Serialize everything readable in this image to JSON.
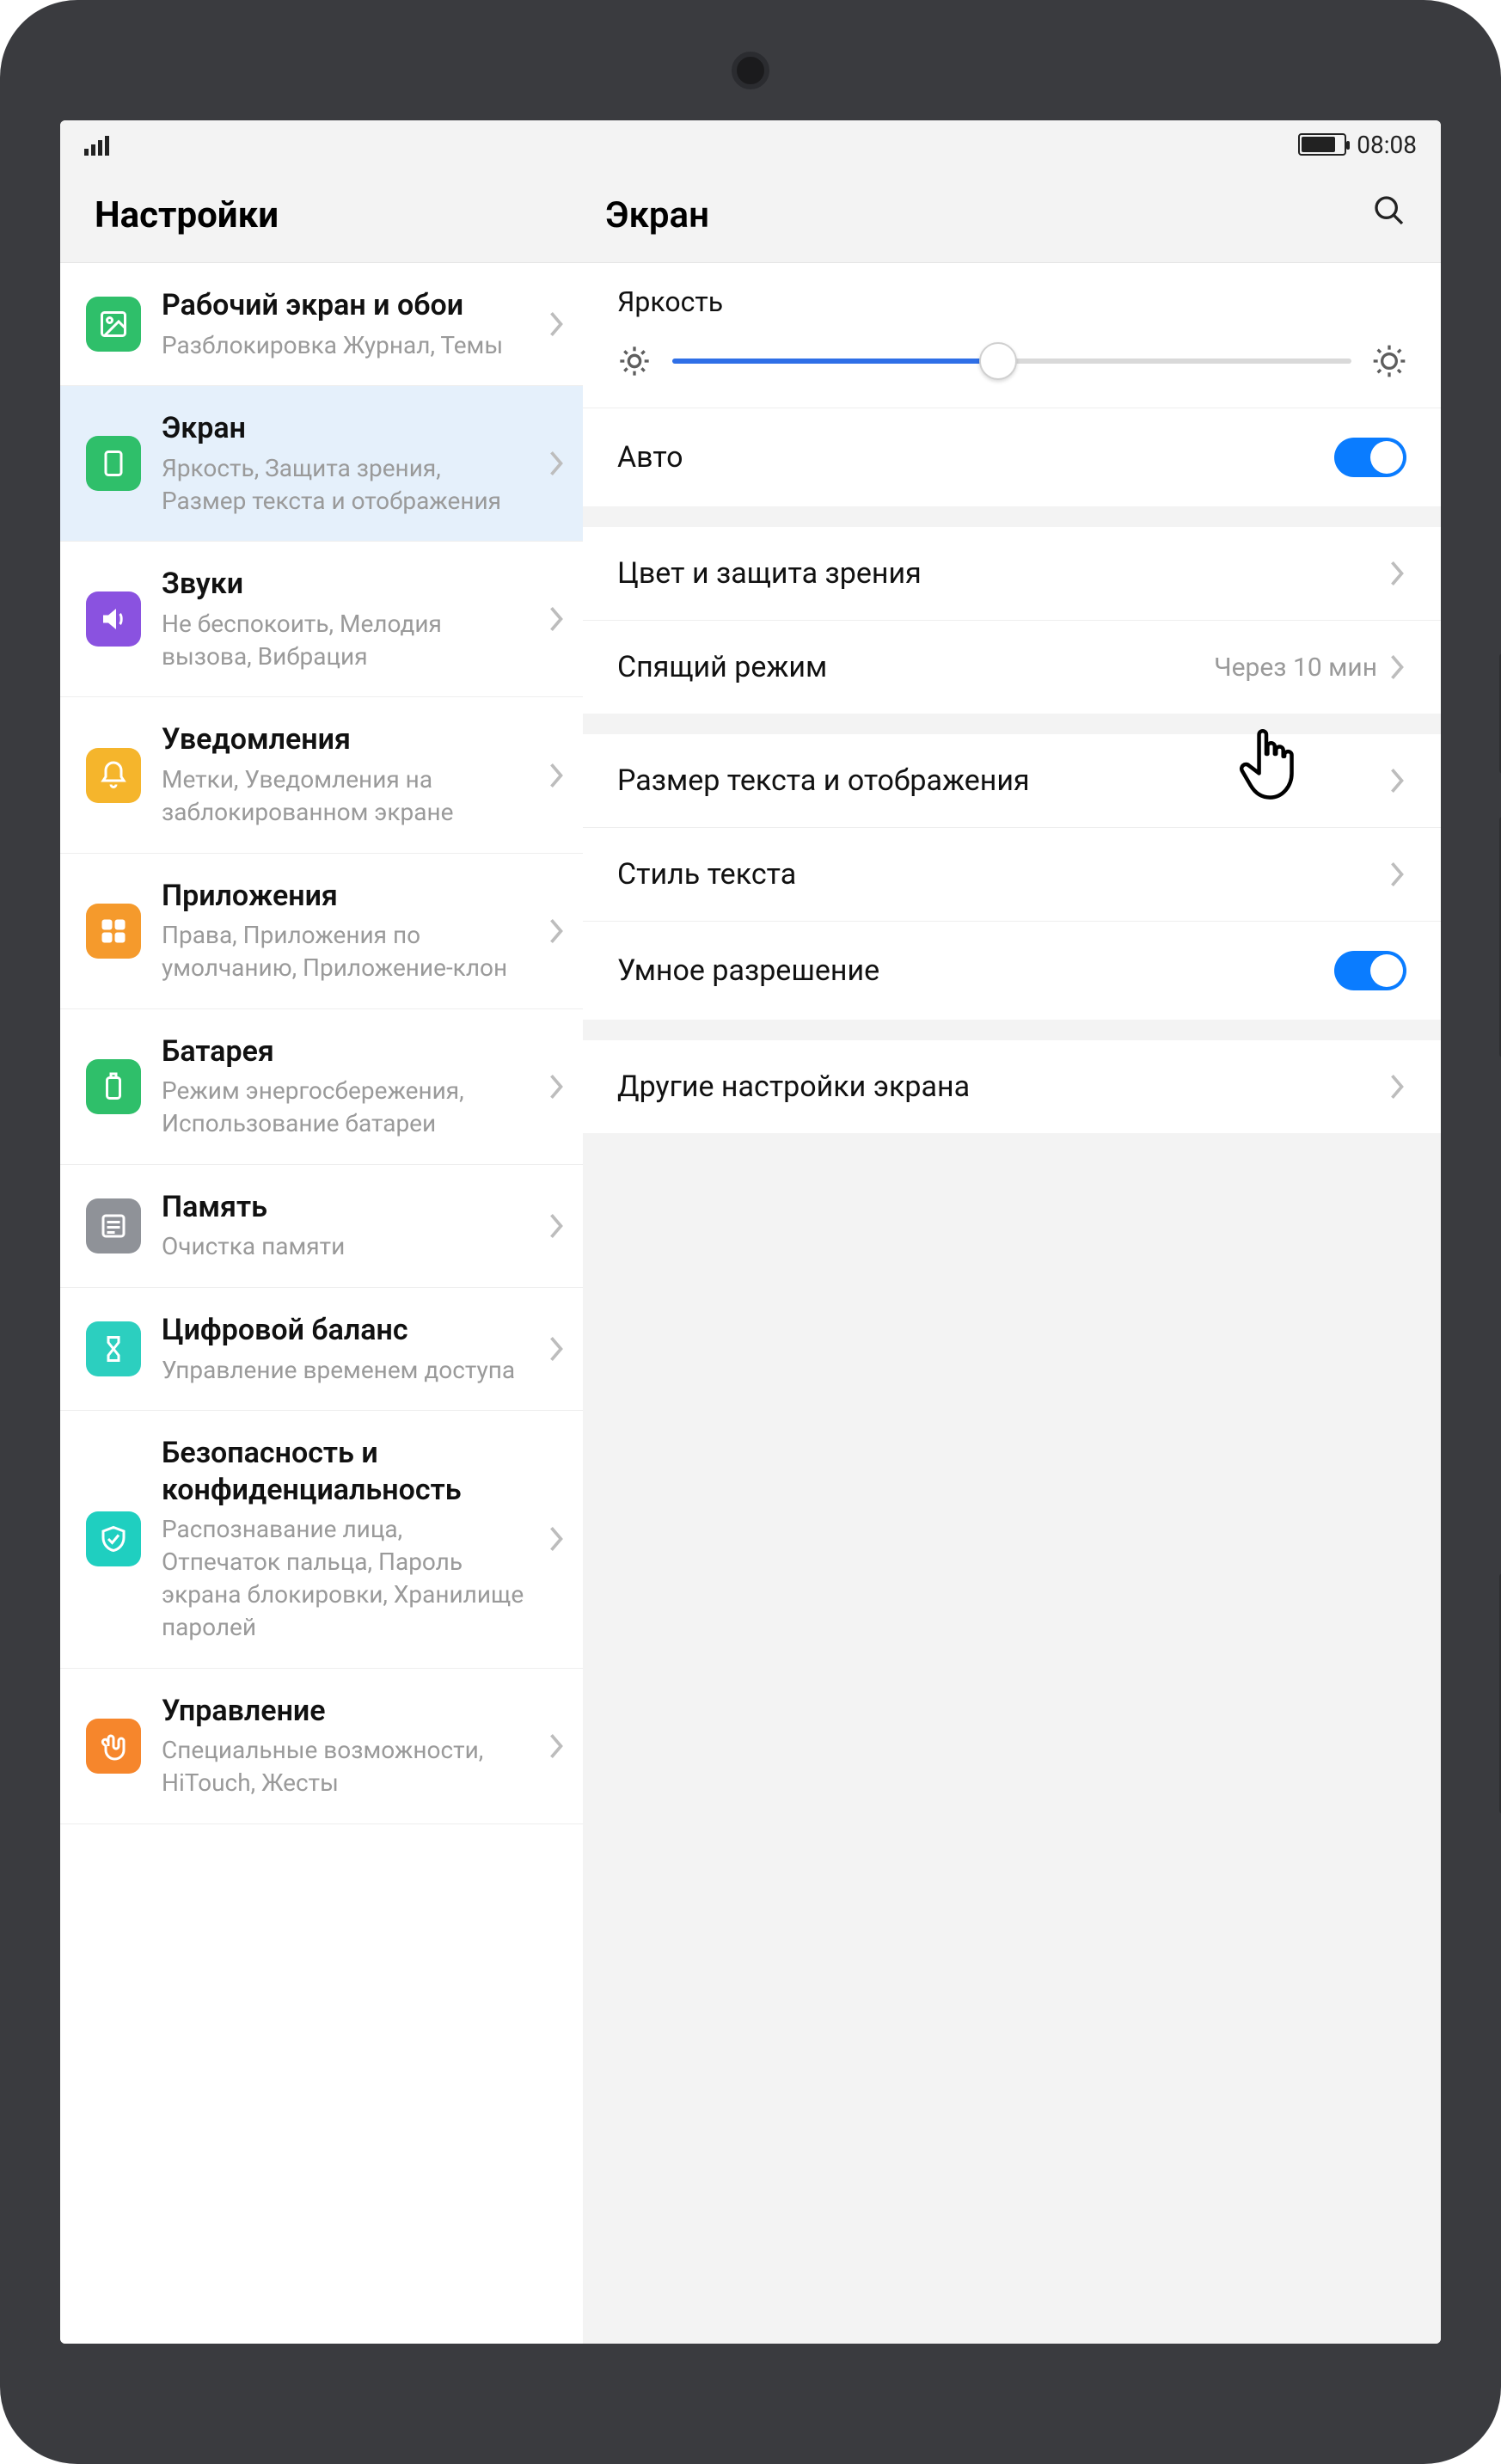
{
  "status": {
    "time": "08:08"
  },
  "sidebar": {
    "title": "Настройки",
    "items": [
      {
        "title": "Рабочий экран и обои",
        "subtitle": "Разблокировка Журнал, Темы"
      },
      {
        "title": "Экран",
        "subtitle": "Яркость, Защита зрения, Размер текста и отображения"
      },
      {
        "title": "Звуки",
        "subtitle": "Не беспокоить, Мелодия вызова, Вибрация"
      },
      {
        "title": "Уведомления",
        "subtitle": "Метки, Уведомления на заблокированном экране"
      },
      {
        "title": "Приложения",
        "subtitle": "Права, Приложения по умолчанию, Приложение-клон"
      },
      {
        "title": "Батарея",
        "subtitle": "Режим энергосбережения, Использование батареи"
      },
      {
        "title": "Память",
        "subtitle": "Очистка памяти"
      },
      {
        "title": "Цифровой баланс",
        "subtitle": "Управление временем доступа"
      },
      {
        "title": "Безопасность и конфиденциальность",
        "subtitle": "Распознавание лица, Отпечаток пальца, Пароль экрана блокировки, Хранилище паролей"
      },
      {
        "title": "Управление",
        "subtitle": "Специальные возможности, HiTouch, Жесты"
      }
    ]
  },
  "detail": {
    "title": "Экран",
    "brightness_label": "Яркость",
    "auto_label": "Авто",
    "rows": {
      "color_protect": "Цвет и защита зрения",
      "sleep": "Спящий режим",
      "sleep_value": "Через 10 мин",
      "text_size": "Размер текста и отображения",
      "text_style": "Стиль текста",
      "smart_res": "Умное разрешение",
      "other": "Другие настройки экрана"
    }
  }
}
